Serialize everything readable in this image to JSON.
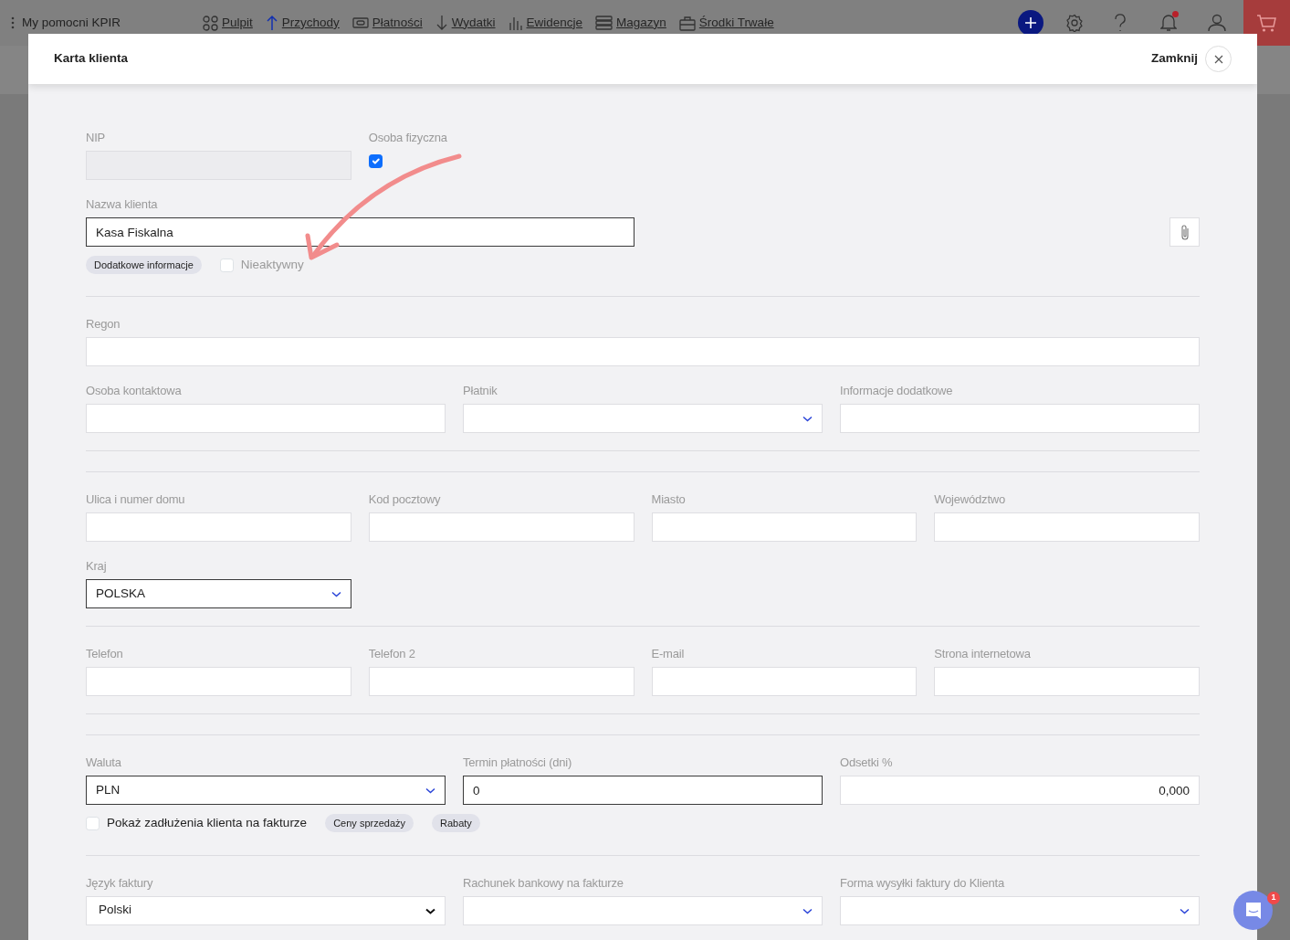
{
  "top_bar": {
    "title": "My pomocni KPIR",
    "nav": [
      {
        "label": "Pulpit"
      },
      {
        "label": "Przychody"
      },
      {
        "label": "Płatności"
      },
      {
        "label": "Wydatki"
      },
      {
        "label": "Ewidencje"
      },
      {
        "label": "Magazyn"
      },
      {
        "label": "Środki Trwałe"
      }
    ],
    "notification_dot": true
  },
  "modal": {
    "title": "Karta klienta",
    "close_label": "Zamknij"
  },
  "form": {
    "rows": [
      {
        "fields": [
          {
            "kind": "text",
            "label": "NIP",
            "disabled": true,
            "required": false
          },
          {
            "kind": "checkbox",
            "label": "Osoba fizyczna",
            "checked": true
          }
        ]
      },
      {
        "fields": [
          {
            "kind": "text",
            "label": "Nazwa klienta",
            "value": "Kasa Fiskalna",
            "disabled": false,
            "required": true
          },
          {
            "kind": "attach"
          }
        ]
      },
      {
        "fields": [
          {
            "kind": "pill",
            "label": "Dodatkowe informacje"
          },
          {
            "kind": "inline-checkbox",
            "label": "Nieaktywny",
            "checked": false,
            "muted": true
          }
        ]
      },
      {
        "fields": [
          {
            "kind": "text",
            "label": "Regon",
            "disabled": false,
            "required": false
          }
        ]
      },
      {
        "fields": [
          {
            "kind": "text",
            "label": "Osoba kontaktowa",
            "disabled": false,
            "required": false
          },
          {
            "kind": "select",
            "label": "Płatnik",
            "required": false
          },
          {
            "kind": "text",
            "label": "Informacje dodatkowe",
            "disabled": false,
            "required": false
          }
        ]
      },
      {
        "fields": [
          {
            "kind": "text",
            "label": "Ulica i numer domu",
            "disabled": false,
            "required": false
          },
          {
            "kind": "text",
            "label": "Kod pocztowy",
            "disabled": false,
            "required": false
          },
          {
            "kind": "text",
            "label": "Miasto",
            "disabled": false,
            "required": false
          },
          {
            "kind": "text",
            "label": "Województwo",
            "disabled": false,
            "required": false
          }
        ]
      },
      {
        "fields": [
          {
            "kind": "select",
            "label": "Kraj",
            "value": "POLSKA",
            "required": true
          }
        ]
      },
      {
        "fields": [
          {
            "kind": "text",
            "label": "Telefon",
            "disabled": false,
            "required": false
          },
          {
            "kind": "text",
            "label": "Telefon 2",
            "disabled": false,
            "required": false
          },
          {
            "kind": "text",
            "label": "E-mail",
            "disabled": false,
            "required": false
          },
          {
            "kind": "text",
            "label": "Strona internetowa",
            "disabled": false,
            "required": false
          }
        ]
      },
      {
        "fields": [
          {
            "kind": "select",
            "label": "Waluta",
            "value": "PLN",
            "required": true
          },
          {
            "kind": "text",
            "label": "Termin płatności (dni)",
            "value": "0",
            "disabled": false,
            "required": true
          },
          {
            "kind": "number",
            "label": "Odsetki %",
            "value": "0,000",
            "disabled": false,
            "required": false
          }
        ]
      },
      {
        "fields": [
          {
            "kind": "inline-checkbox",
            "label": "Pokaż zadłużenia klienta na fakturze",
            "checked": false,
            "muted": false
          },
          {
            "kind": "pill",
            "label": "Ceny sprzedaży"
          },
          {
            "kind": "pill",
            "label": "Rabaty"
          }
        ]
      },
      {
        "fields": [
          {
            "kind": "native-select",
            "label": "Język faktury",
            "value": "Polski",
            "required": false
          },
          {
            "kind": "select",
            "label": "Rachunek bankowy na fakturze",
            "required": false
          },
          {
            "kind": "select",
            "label": "Forma wysyłki faktury do Klienta",
            "required": false
          }
        ]
      }
    ]
  },
  "chat": {
    "badge": "1"
  }
}
